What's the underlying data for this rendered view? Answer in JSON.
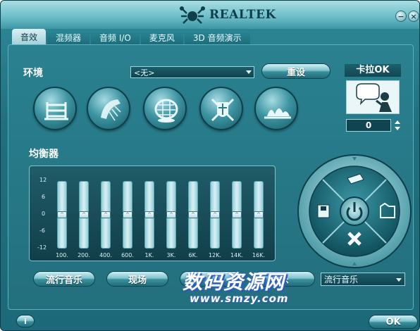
{
  "window": {
    "brand": "REALTEK",
    "minimize_symbol": "−",
    "close_symbol": "×"
  },
  "tabs": [
    {
      "label": "音效",
      "active": true
    },
    {
      "label": "混频器",
      "active": false
    },
    {
      "label": "音频 I/O",
      "active": false
    },
    {
      "label": "麦克风",
      "active": false
    },
    {
      "label": "3D 音频演示",
      "active": false
    }
  ],
  "environment": {
    "label": "环境",
    "selected": "<无>",
    "reset_label": "重设",
    "icons": [
      "stairs-icon",
      "shower-icon",
      "stadium-icon",
      "knight-shield-icon",
      "opera-house-icon"
    ]
  },
  "karaoke": {
    "label": "卡拉OK",
    "value": "0"
  },
  "equalizer": {
    "label": "均衡器",
    "db_labels": [
      "12",
      "6",
      "0",
      "-6",
      "-12"
    ],
    "bands": [
      "100.",
      "200.",
      "400.",
      "600.",
      "1K.",
      "3K.",
      "6K.",
      "12K.",
      "14K.",
      "16K."
    ],
    "levels_db": [
      0,
      0,
      0,
      0,
      0,
      0,
      0,
      0,
      0,
      0
    ],
    "preset_buttons": [
      "流行音乐",
      "现场",
      "",
      "乐"
    ],
    "preset_selected": "流行音乐"
  },
  "watermark": {
    "text": "数码资源网",
    "url": "www.smzy.com"
  },
  "footer": {
    "info_label": "i",
    "ok_label": "OK"
  },
  "colors": {
    "window_bg": "#1f6f7e",
    "accent": "#7fc2cc"
  }
}
